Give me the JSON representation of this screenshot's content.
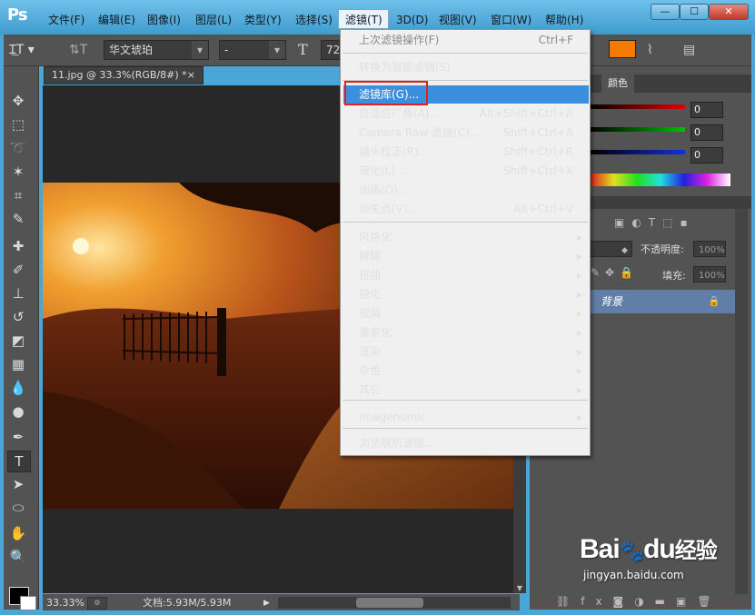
{
  "app": {
    "logo": "Ps",
    "menus": [
      "文件(F)",
      "编辑(E)",
      "图像(I)",
      "图层(L)",
      "类型(Y)",
      "选择(S)",
      "滤镜(T)",
      "3D(D)",
      "视图(V)",
      "窗口(W)",
      "帮助(H)"
    ],
    "window_controls": [
      "—",
      "☐",
      "✕"
    ]
  },
  "options_bar": {
    "font_name": "华文琥珀",
    "font_style": "-",
    "font_size": "72",
    "text_color": "#f47a00"
  },
  "document": {
    "tab_title": "11.jpg @ 33.3%(RGB/8#) *",
    "tab_close": "×",
    "zoom": "33.33%",
    "doc_info": "文档:5.93M/5.93M"
  },
  "filter_menu": {
    "items": [
      {
        "label": "上次滤镜操作(F)",
        "shortcut": "Ctrl+F",
        "disabled": true
      },
      {
        "label": "转换为智能滤镜(S)",
        "shortcut": ""
      },
      {
        "label": "滤镜库(G)...",
        "shortcut": "",
        "highlighted": true
      },
      {
        "label": "自适应广角(A)...",
        "shortcut": "Alt+Shift+Ctrl+A"
      },
      {
        "label": "Camera Raw 滤镜(C)...",
        "shortcut": "Shift+Ctrl+A"
      },
      {
        "label": "镜头校正(R)...",
        "shortcut": "Shift+Ctrl+R"
      },
      {
        "label": "液化(L)...",
        "shortcut": "Shift+Ctrl+X"
      },
      {
        "label": "油画(O)...",
        "shortcut": ""
      },
      {
        "label": "消失点(V)...",
        "shortcut": "Alt+Ctrl+V"
      },
      {
        "label": "风格化",
        "submenu": true
      },
      {
        "label": "模糊",
        "submenu": true
      },
      {
        "label": "扭曲",
        "submenu": true
      },
      {
        "label": "锐化",
        "submenu": true
      },
      {
        "label": "视频",
        "submenu": true
      },
      {
        "label": "像素化",
        "submenu": true
      },
      {
        "label": "渲染",
        "submenu": true
      },
      {
        "label": "杂色",
        "submenu": true
      },
      {
        "label": "其它",
        "submenu": true
      },
      {
        "label": "Imagenomic",
        "submenu": true
      },
      {
        "label": "浏览联机滤镜...",
        "shortcut": ""
      }
    ]
  },
  "color_panel": {
    "tab": "颜色",
    "r": "0",
    "g": "0",
    "b": "0"
  },
  "layers_panel": {
    "opacity_label": "不透明度:",
    "opacity_value": "100%",
    "fill_label": "填充:",
    "fill_value": "100%",
    "layer_name": "背景"
  },
  "watermark": {
    "brand": "Bai",
    "brand2": "du",
    "cn": "经验",
    "url": "jingyan.baidu.com"
  }
}
